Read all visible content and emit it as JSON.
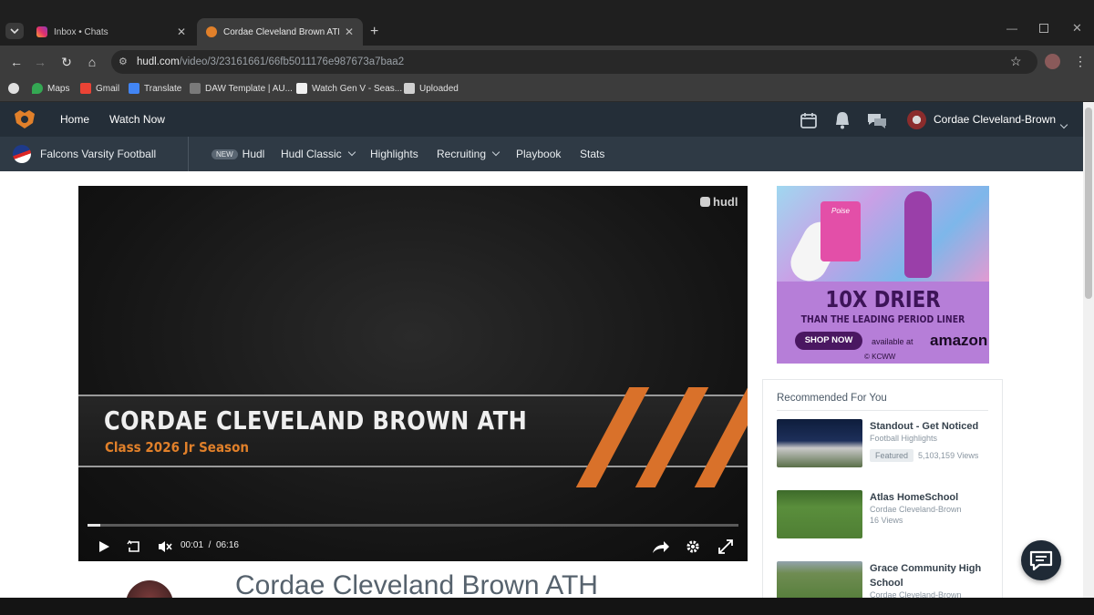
{
  "browser": {
    "tabs": [
      {
        "title": "Inbox • Chats",
        "active": false
      },
      {
        "title": "Cordae Cleveland Brown ATH C",
        "active": true
      }
    ],
    "url": {
      "host": "hudl.com",
      "path": "/video/3/23161661/66fb5011176e987673a7baa2"
    },
    "bookmarks": [
      "Maps",
      "Gmail",
      "Translate",
      "DAW Template | AU...",
      "Watch Gen V - Seas...",
      "Uploaded"
    ]
  },
  "hudl_nav": {
    "home": "Home",
    "watch_now": "Watch Now",
    "user_name": "Cordae Cleveland-Brown"
  },
  "sub_nav": {
    "team": "Falcons Varsity Football",
    "new_badge": "NEW",
    "hudl": "Hudl",
    "hudl_classic": "Hudl Classic",
    "highlights": "Highlights",
    "recruiting": "Recruiting",
    "playbook": "Playbook",
    "stats": "Stats"
  },
  "video": {
    "watermark": "hudl",
    "banner_title": "CORDAE CLEVELAND BROWN ATH",
    "banner_subtitle": "Class 2026 Jr Season",
    "current_time": "00:01",
    "separator": "/",
    "duration": "06:16",
    "progress_fraction": 0.02
  },
  "ad": {
    "headline": "10X DRIER",
    "subline": "THAN THE LEADING PERIOD LINER",
    "cta": "SHOP NOW",
    "available": "available at",
    "retailer": "amazon",
    "copyright": "© KCWW",
    "brand": "Poise"
  },
  "recommended": {
    "header": "Recommended For You",
    "items": [
      {
        "title": "Standout - Get Noticed",
        "subtitle": "Football Highlights",
        "tag": "Featured",
        "views": "5,103,159 Views"
      },
      {
        "title": "Atlas HomeSchool",
        "subtitle": "Cordae Cleveland-Brown",
        "tag": "",
        "views": "16 Views"
      },
      {
        "title": "Grace Community High School",
        "subtitle": "Cordae Cleveland-Brown",
        "tag": "",
        "views": ""
      }
    ]
  },
  "page": {
    "video_title": "Cordae Cleveland Brown ATH"
  },
  "colors": {
    "hudl_orange": "#e1802a",
    "nav_bg": "#242e38",
    "subnav_bg": "#2f3a45"
  }
}
